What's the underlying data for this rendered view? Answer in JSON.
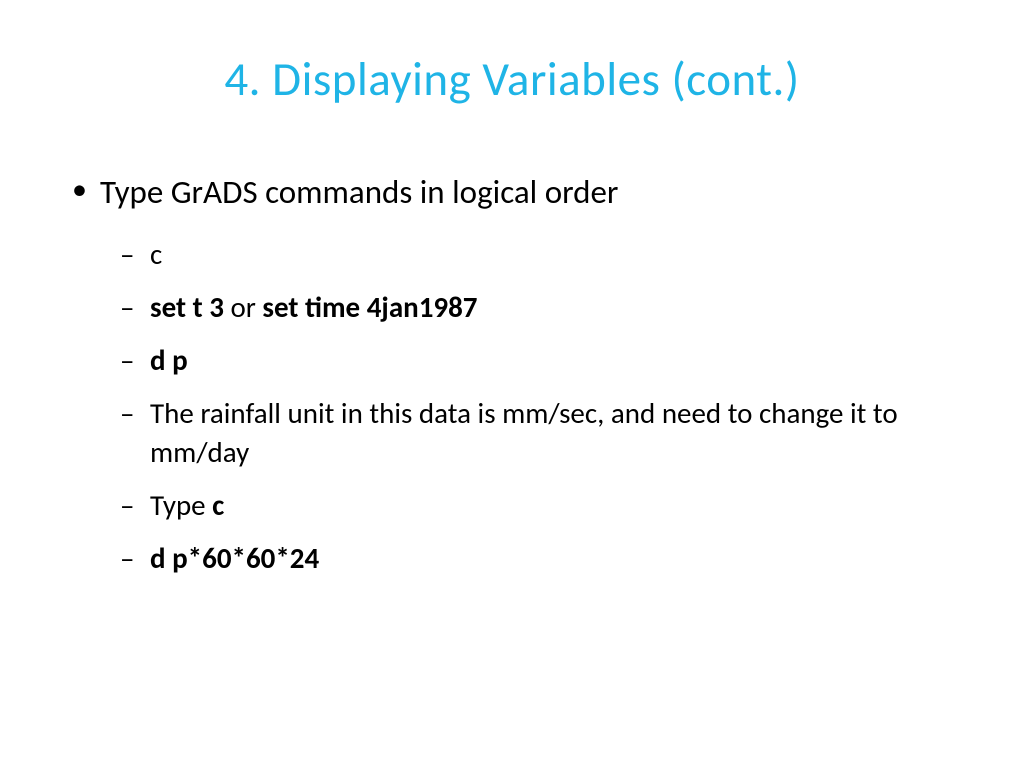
{
  "title": "4. Displaying Variables (cont.)",
  "bullet1": {
    "text": "Type GrADS commands in logical order",
    "subitems": {
      "item1": "c",
      "item2": {
        "part1": "set t 3",
        "part2": " or ",
        "part3": "set time 4jan1987"
      },
      "item3": "d p",
      "item4": "The rainfall unit in this data is mm/sec, and need to change it to mm/day",
      "item5": {
        "part1": "Type ",
        "part2": "c"
      },
      "item6": "d p*60*60*24"
    }
  }
}
